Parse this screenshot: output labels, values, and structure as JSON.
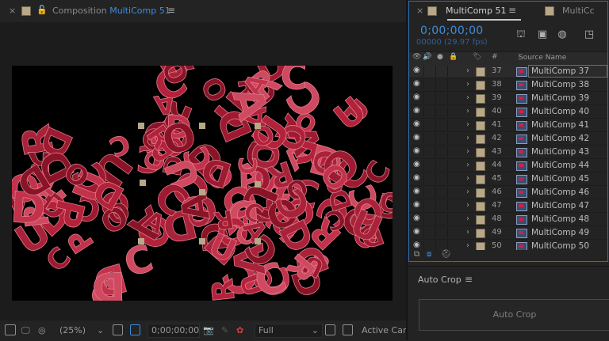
{
  "comp_panel": {
    "title_prefix": "Composition",
    "title_name": "MultiComp 51",
    "close_glyph": "×",
    "menu_glyph": "≡"
  },
  "comp_toolbar": {
    "zoom": "(25%)",
    "timecode": "0;00;00;00",
    "resolution": "Full",
    "view": "Active Can",
    "icons": [
      "region-of-interest-icon",
      "monitor-icon",
      "mask-icon",
      "grid-icon",
      "transparency-grid-icon",
      "camera-snapshot-icon",
      "show-snapshot-icon",
      "color-channel-icon",
      "fast-previews-icon",
      "toggle-transparency-icon"
    ]
  },
  "timeline_panel": {
    "tab_name": "MultiComp 51",
    "tab_name_2": "MultiCc",
    "close_glyph": "×",
    "menu_glyph": "≡",
    "timecode": "0;00;00;00",
    "frame_info": "00000 (29.97 fps)",
    "tools": [
      "comp-flowchart-icon",
      "render-queue-icon",
      "motion-blur-icon",
      "graph-editor-icon"
    ],
    "headers": {
      "number": "#",
      "source_name": "Source Name"
    },
    "layers": [
      {
        "num": "37",
        "name": "MultiComp 37",
        "selected": true
      },
      {
        "num": "38",
        "name": "MultiComp 38"
      },
      {
        "num": "39",
        "name": "MultiComp 39"
      },
      {
        "num": "40",
        "name": "MultiComp 40"
      },
      {
        "num": "41",
        "name": "MultiComp 41"
      },
      {
        "num": "42",
        "name": "MultiComp 42"
      },
      {
        "num": "43",
        "name": "MultiComp 43"
      },
      {
        "num": "44",
        "name": "MultiComp 44"
      },
      {
        "num": "45",
        "name": "MultiComp 45"
      },
      {
        "num": "46",
        "name": "MultiComp 46"
      },
      {
        "num": "47",
        "name": "MultiComp 47"
      },
      {
        "num": "48",
        "name": "MultiComp 48"
      },
      {
        "num": "49",
        "name": "MultiComp 49"
      },
      {
        "num": "50",
        "name": "MultiComp 50"
      }
    ]
  },
  "auto_crop": {
    "title": "Auto Crop",
    "menu_glyph": "≡",
    "button_label": "Auto Crop"
  },
  "colors": {
    "accent_blue": "#3d8ddd",
    "label_tan": "#b9a888",
    "letter_red": "#b3213a",
    "panel_bg": "#232323"
  }
}
